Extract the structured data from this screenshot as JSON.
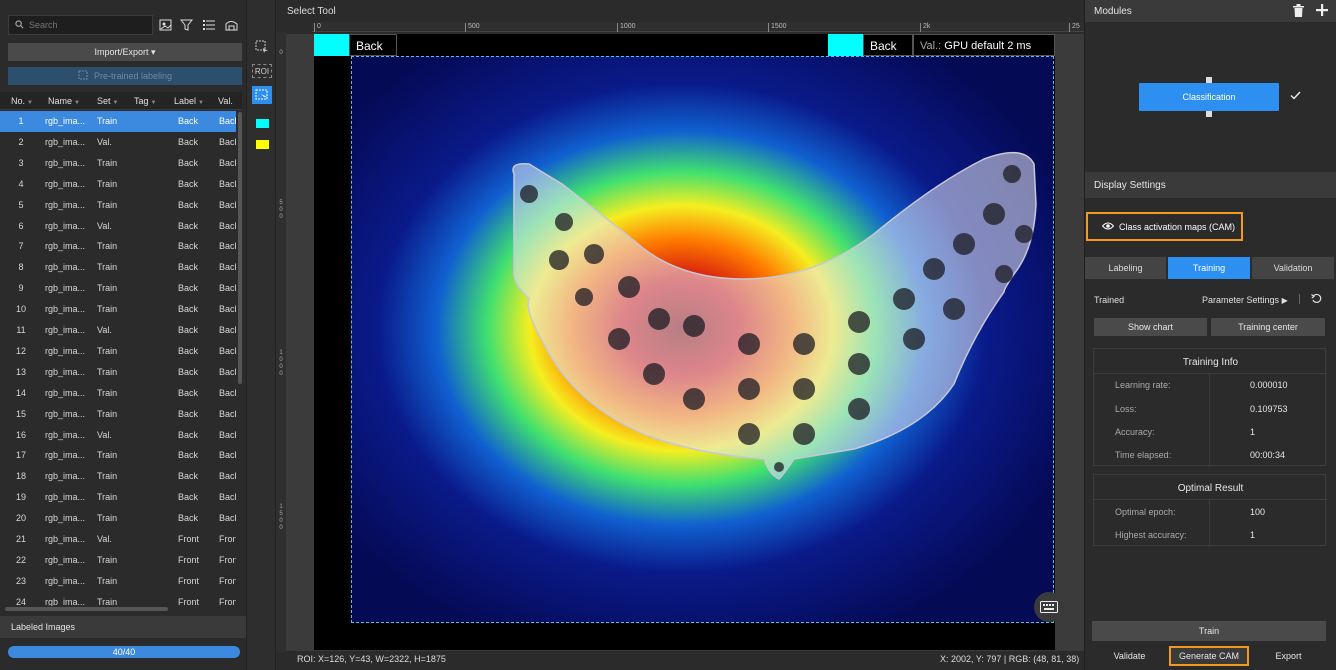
{
  "left": {
    "search_placeholder": "Search",
    "import_export": "Import/Export ▾",
    "pretrained": "Pre-trained labeling",
    "columns": [
      "No.",
      "Name",
      "Set",
      "Tag",
      "Label",
      "Val."
    ],
    "rows": [
      {
        "no": "1",
        "name": "rgb_ima...",
        "set": "Train",
        "tag": "",
        "label": "Back",
        "val": "Back"
      },
      {
        "no": "2",
        "name": "rgb_ima...",
        "set": "Val.",
        "tag": "",
        "label": "Back",
        "val": "Back"
      },
      {
        "no": "3",
        "name": "rgb_ima...",
        "set": "Train",
        "tag": "",
        "label": "Back",
        "val": "Back"
      },
      {
        "no": "4",
        "name": "rgb_ima...",
        "set": "Train",
        "tag": "",
        "label": "Back",
        "val": "Back"
      },
      {
        "no": "5",
        "name": "rgb_ima...",
        "set": "Train",
        "tag": "",
        "label": "Back",
        "val": "Back"
      },
      {
        "no": "6",
        "name": "rgb_ima...",
        "set": "Val.",
        "tag": "",
        "label": "Back",
        "val": "Back"
      },
      {
        "no": "7",
        "name": "rgb_ima...",
        "set": "Train",
        "tag": "",
        "label": "Back",
        "val": "Back"
      },
      {
        "no": "8",
        "name": "rgb_ima...",
        "set": "Train",
        "tag": "",
        "label": "Back",
        "val": "Back"
      },
      {
        "no": "9",
        "name": "rgb_ima...",
        "set": "Train",
        "tag": "",
        "label": "Back",
        "val": "Back"
      },
      {
        "no": "10",
        "name": "rgb_ima...",
        "set": "Train",
        "tag": "",
        "label": "Back",
        "val": "Back"
      },
      {
        "no": "11",
        "name": "rgb_ima...",
        "set": "Val.",
        "tag": "",
        "label": "Back",
        "val": "Back"
      },
      {
        "no": "12",
        "name": "rgb_ima...",
        "set": "Train",
        "tag": "",
        "label": "Back",
        "val": "Back"
      },
      {
        "no": "13",
        "name": "rgb_ima...",
        "set": "Train",
        "tag": "",
        "label": "Back",
        "val": "Back"
      },
      {
        "no": "14",
        "name": "rgb_ima...",
        "set": "Train",
        "tag": "",
        "label": "Back",
        "val": "Back"
      },
      {
        "no": "15",
        "name": "rgb_ima...",
        "set": "Train",
        "tag": "",
        "label": "Back",
        "val": "Back"
      },
      {
        "no": "16",
        "name": "rgb_ima...",
        "set": "Val.",
        "tag": "",
        "label": "Back",
        "val": "Back"
      },
      {
        "no": "17",
        "name": "rgb_ima...",
        "set": "Train",
        "tag": "",
        "label": "Back",
        "val": "Back"
      },
      {
        "no": "18",
        "name": "rgb_ima...",
        "set": "Train",
        "tag": "",
        "label": "Back",
        "val": "Back"
      },
      {
        "no": "19",
        "name": "rgb_ima...",
        "set": "Train",
        "tag": "",
        "label": "Back",
        "val": "Back"
      },
      {
        "no": "20",
        "name": "rgb_ima...",
        "set": "Train",
        "tag": "",
        "label": "Back",
        "val": "Back"
      },
      {
        "no": "21",
        "name": "rgb_ima...",
        "set": "Val.",
        "tag": "",
        "label": "Front",
        "val": "Front"
      },
      {
        "no": "22",
        "name": "rgb_ima...",
        "set": "Train",
        "tag": "",
        "label": "Front",
        "val": "Front"
      },
      {
        "no": "23",
        "name": "rgb_ima...",
        "set": "Train",
        "tag": "",
        "label": "Front",
        "val": "Front"
      },
      {
        "no": "24",
        "name": "rgb_ima...",
        "set": "Train",
        "tag": "",
        "label": "Front",
        "val": "Front"
      }
    ],
    "labeled_images": "Labeled Images",
    "progress_text": "40/40"
  },
  "toolbar": {
    "roi_label": "ROI"
  },
  "center": {
    "select_tool": "Select Tool",
    "ruler_ticks": [
      "0",
      "500",
      "1000",
      "1500",
      "2k",
      "25"
    ],
    "vruler_ticks": [
      "0",
      "5 0 0",
      "1 0 0 0",
      "1 5 0 0"
    ],
    "left_tag": "Back",
    "right_tag": "Back",
    "val_label": "Val.:",
    "val_text": "GPU default 2 ms",
    "roi_status": "ROI: X=126, Y=43, W=2322, H=1875",
    "pixel_status": "X: 2002, Y: 797 | RGB: (48, 81, 38)"
  },
  "right": {
    "modules_title": "Modules",
    "module_node": "Classification",
    "display_settings": "Display Settings",
    "cam_label": "Class activation maps (CAM)",
    "tabs": [
      "Labeling",
      "Training",
      "Validation"
    ],
    "trained": "Trained",
    "param_settings": "Parameter Settings",
    "show_chart": "Show chart",
    "training_center": "Training center",
    "training_info": {
      "title": "Training Info",
      "rows": [
        {
          "label": "Learning rate:",
          "value": "0.000010"
        },
        {
          "label": "Loss:",
          "value": "0.109753"
        },
        {
          "label": "Accuracy:",
          "value": "1"
        },
        {
          "label": "Time elapsed:",
          "value": "00:00:34"
        }
      ]
    },
    "optimal_result": {
      "title": "Optimal Result",
      "rows": [
        {
          "label": "Optimal epoch:",
          "value": "100"
        },
        {
          "label": "Highest accuracy:",
          "value": "1"
        }
      ]
    },
    "train": "Train",
    "validate": "Validate",
    "generate_cam": "Generate CAM",
    "export": "Export"
  },
  "colors": {
    "accent": "#2d8ff0",
    "highlight": "#f39a1e",
    "tag": "#00ffff"
  }
}
